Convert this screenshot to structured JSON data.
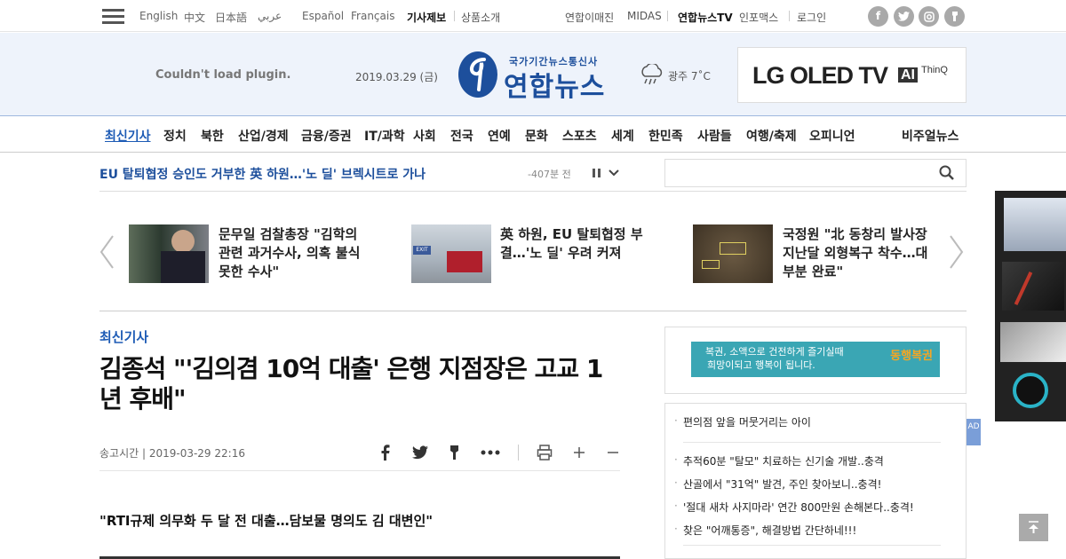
{
  "topbar": {
    "languages": [
      "English",
      "中文",
      "日本語",
      "عربي",
      "Español",
      "Français"
    ],
    "links_left": [
      "기사제보",
      "상품소개"
    ],
    "links_right": [
      "연합이매진",
      "MIDAS",
      "연합뉴스TV",
      "인포맥스",
      "로그인"
    ],
    "social": [
      "f",
      "t",
      "ig",
      "k"
    ]
  },
  "header": {
    "plugin_msg": "Couldn't load plugin.",
    "date": "2019.03.29 (금)",
    "logo_sub": "국가기간뉴스통신사",
    "logo_text": "연합뉴스",
    "weather": "광주 7˚C",
    "ad": {
      "brand": "LG OLED TV",
      "ai": "AI",
      "thinq": "ThinQ"
    }
  },
  "nav": {
    "items": [
      "최신기사",
      "정치",
      "북한",
      "산업/경제",
      "금융/증권",
      "IT/과학",
      "사회",
      "전국",
      "연예",
      "문화",
      "스포츠",
      "세계",
      "한민족",
      "사람들",
      "여행/축제",
      "오피니언"
    ],
    "visual": "비주얼뉴스"
  },
  "ticker": {
    "headline": "EU 탈퇴협정 승인도 거부한 英 하원…'노 딜' 브렉시트로 가나",
    "time": "-407분 전"
  },
  "cards": [
    {
      "text": "문무일 검찰총장 \"김학의 관련 과거수사, 의혹 불식 못한 수사\""
    },
    {
      "text": "英 하원, EU 탈퇴협정 부결…'노 딜' 우려 커져"
    },
    {
      "text": "국정원 \"北 동창리 발사장 지난달 외형복구 착수…대부분 완료\""
    }
  ],
  "article": {
    "section": "최신기사",
    "headline": "김종석 \"'김의겸 10억 대출' 은행 지점장은 고교 1년 후배\"",
    "pubtime": "송고시간 | 2019-03-29 22:16",
    "subhead": "\"RTI규제 의무화 두 달 전 대출…담보물 명의도 김 대변인\""
  },
  "sidebar": {
    "lotto_line1": "복권, 소액으로 건전하게 즐기실때",
    "lotto_line2": "희망이되고 행복이 됩니다.",
    "lotto_brand": "동행복권",
    "items": [
      "편의점 앞을 머뭇거리는 아이",
      "추적60분 \"탈모\" 치료하는 신기술 개발..충격",
      "산골에서 \"31억\" 발견, 주인 찾아보니..충격!",
      "'절대 새차 사지마라' 연간 800만원 손해본다..충격!",
      "찾은 \"어깨통증\", 해결방법 간단하네!!!"
    ],
    "ad_tag": "AD"
  },
  "colors": {
    "brand": "#1d4f9c",
    "accent": "#1d5bb5",
    "header_bg": "#eef3fb"
  }
}
